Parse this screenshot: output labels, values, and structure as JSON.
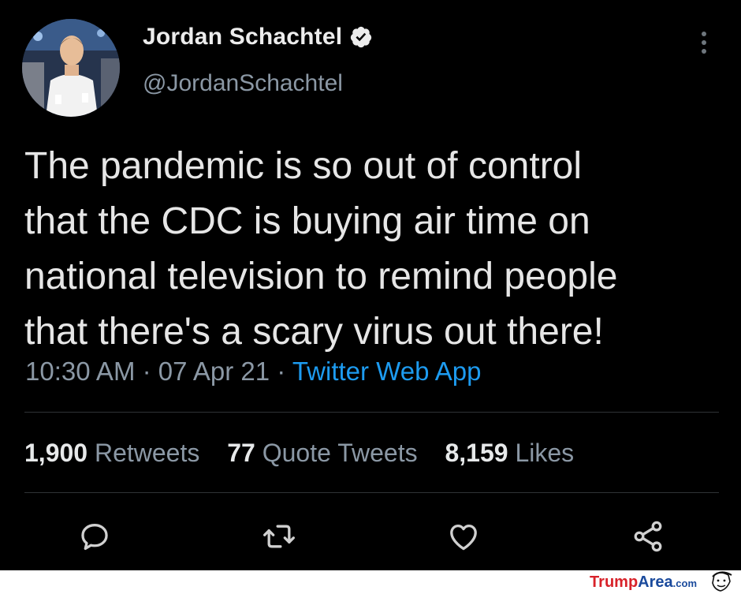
{
  "author": {
    "name": "Jordan Schachtel",
    "handle": "@JordanSchachtel",
    "verified": true
  },
  "tweet": {
    "lines": [
      "The pandemic is so out of control",
      "that the CDC is buying air time on",
      "national television to remind people",
      "that there's a scary virus out there!"
    ],
    "time": "10:30 AM",
    "date": "07 Apr 21",
    "separator": "·",
    "source": "Twitter Web App"
  },
  "stats": {
    "retweets_count": "1,900",
    "retweets_label": "Retweets",
    "quotes_count": "77",
    "quotes_label": "Quote Tweets",
    "likes_count": "8,159",
    "likes_label": "Likes"
  },
  "actions": [
    "reply-icon",
    "retweet-icon",
    "like-icon",
    "share-icon"
  ],
  "footer": {
    "logo_part1": "Trump",
    "logo_part2": "Area",
    "logo_part3": ".com"
  },
  "colors": {
    "background": "#000000",
    "text": "#e6e6e6",
    "muted": "#8b98a5",
    "link": "#1d9bf0"
  }
}
